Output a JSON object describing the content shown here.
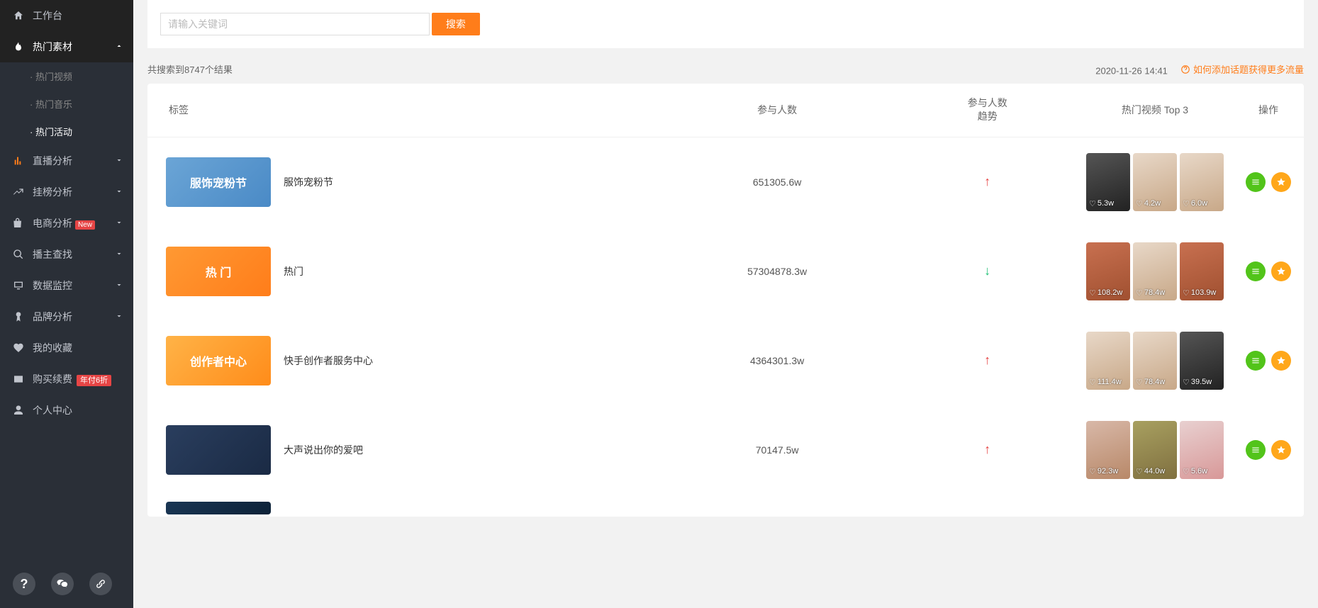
{
  "sidebar": {
    "workbench": "工作台",
    "hot_materials": "热门素材",
    "hot_video": "· 热门视频",
    "hot_music": "· 热门音乐",
    "hot_activity": "· 热门活动",
    "live_analysis": "直播分析",
    "ranking_analysis": "挂榜分析",
    "ecommerce_analysis": "电商分析",
    "ecommerce_badge": "New",
    "anchor_search": "播主查找",
    "data_monitor": "数据监控",
    "brand_analysis": "品牌分析",
    "my_favorites": "我的收藏",
    "buy_renew": "购买续费",
    "buy_badge": "年付6折",
    "personal_center": "个人中心"
  },
  "search": {
    "placeholder": "请输入关键词",
    "button": "搜索"
  },
  "results": {
    "count_text": "共搜索到8747个结果",
    "timestamp": "2020-11-26 14:41",
    "help_link": "如何添加话题获得更多流量"
  },
  "table_headers": {
    "tag": "标签",
    "participants": "参与人数",
    "trend": "参与人数 趋势",
    "top3": "热门视频 Top 3",
    "actions": "操作"
  },
  "rows": [
    {
      "thumb_text": "服饰宠粉节",
      "thumb_class": "",
      "title": "服饰宠粉节",
      "participants": "651305.6w",
      "trend": "up",
      "thumbs": [
        {
          "count": "5.3w",
          "class": "darkpic"
        },
        {
          "count": "4.2w",
          "class": "light"
        },
        {
          "count": "6.0w",
          "class": "light"
        }
      ]
    },
    {
      "thumb_text": "热 门",
      "thumb_class": "orange",
      "title": "热门",
      "participants": "57304878.3w",
      "trend": "down",
      "thumbs": [
        {
          "count": "108.2w",
          "class": "food"
        },
        {
          "count": "78.4w",
          "class": "light"
        },
        {
          "count": "103.9w",
          "class": "food"
        }
      ]
    },
    {
      "thumb_text": "创作者中心",
      "thumb_class": "promo",
      "title": "快手创作者服务中心",
      "participants": "4364301.3w",
      "trend": "up",
      "thumbs": [
        {
          "count": "111.4w",
          "class": "light"
        },
        {
          "count": "78.4w",
          "class": "light"
        },
        {
          "count": "39.5w",
          "class": "darkpic"
        }
      ]
    },
    {
      "thumb_text": "",
      "thumb_class": "dark",
      "title": "大声说出你的爱吧",
      "participants": "70147.5w",
      "trend": "up",
      "thumbs": [
        {
          "count": "92.3w",
          "class": "person"
        },
        {
          "count": "44.0w",
          "class": "group"
        },
        {
          "count": "5.6w",
          "class": "pink"
        }
      ]
    }
  ]
}
